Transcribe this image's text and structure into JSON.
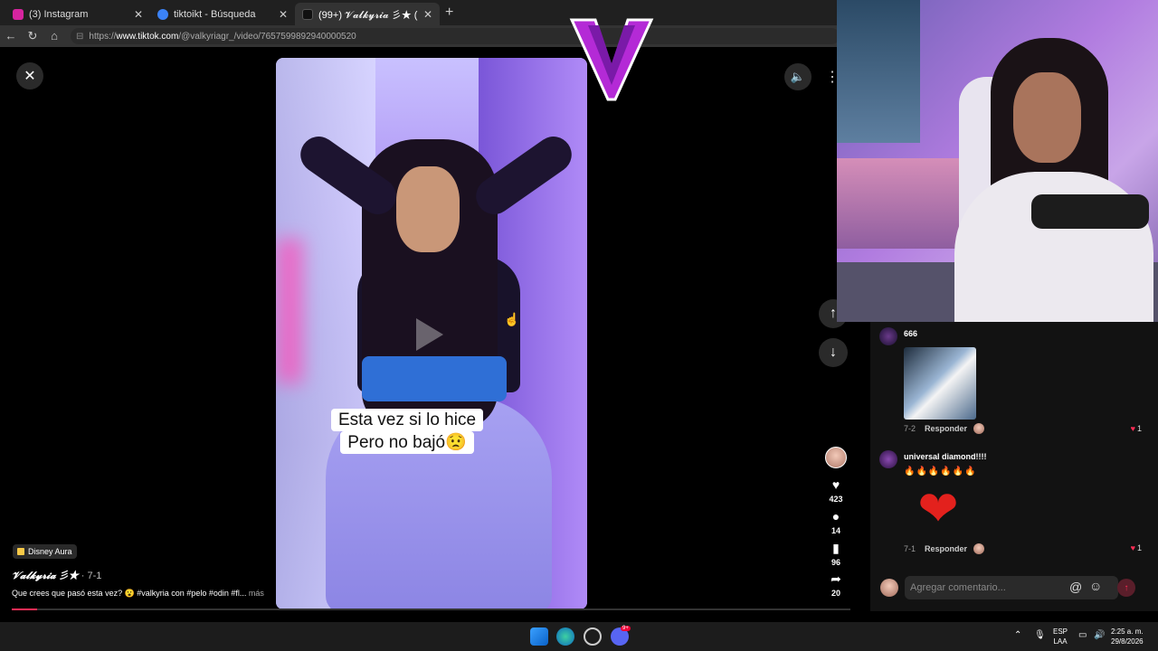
{
  "browser": {
    "tabs": [
      {
        "label": "(3) Instagram",
        "favicon_color": "#d6249f"
      },
      {
        "label": "tiktoikt - Búsqueda",
        "favicon_color": "#3b82f6"
      },
      {
        "label": "(99+) 𝓥𝓪𝓵𝓴𝔂𝓻𝓲𝓪 彡★ (@valkyriagr",
        "favicon_color": "#111111"
      }
    ],
    "url_prefix": "https://",
    "url_host": "www.tiktok.com",
    "url_path": "/@valkyriagr_/video/7657599892940000520"
  },
  "video": {
    "caption_line1": "Esta vez si lo hice",
    "caption_line2": "Pero no bajó😟"
  },
  "actions": {
    "likes": "423",
    "comments": "14",
    "saves": "96",
    "shares": "20"
  },
  "post": {
    "music": "Disney Aura",
    "author": "𝓥𝓪𝓵𝓴𝔂𝓻𝓲𝓪 彡★",
    "date": "· 7-1",
    "description": "Que crees que pasó esta vez? 😮 #valkyria con #pelo #odin #fl...",
    "more_label": "más",
    "progress": 0.03
  },
  "comments": [
    {
      "user": "666",
      "date": "7-2",
      "reply": "Responder",
      "likes": "1",
      "sticker": "gem"
    },
    {
      "user": "universal diamond!!!!",
      "fires": "🔥🔥🔥🔥🔥🔥",
      "date": "7-1",
      "reply": "Responder",
      "likes": "1",
      "sticker": "heart"
    }
  ],
  "comment_input": {
    "placeholder": "Agregar comentario..."
  },
  "taskbar": {
    "lang_line1": "ESP",
    "lang_line2": "LAA",
    "time": "2:25 a. m.",
    "date": "29/8/2026",
    "discord_badge": "9+"
  },
  "colors": {
    "accent": "#fe2c55",
    "logo": "#b42ad6"
  }
}
